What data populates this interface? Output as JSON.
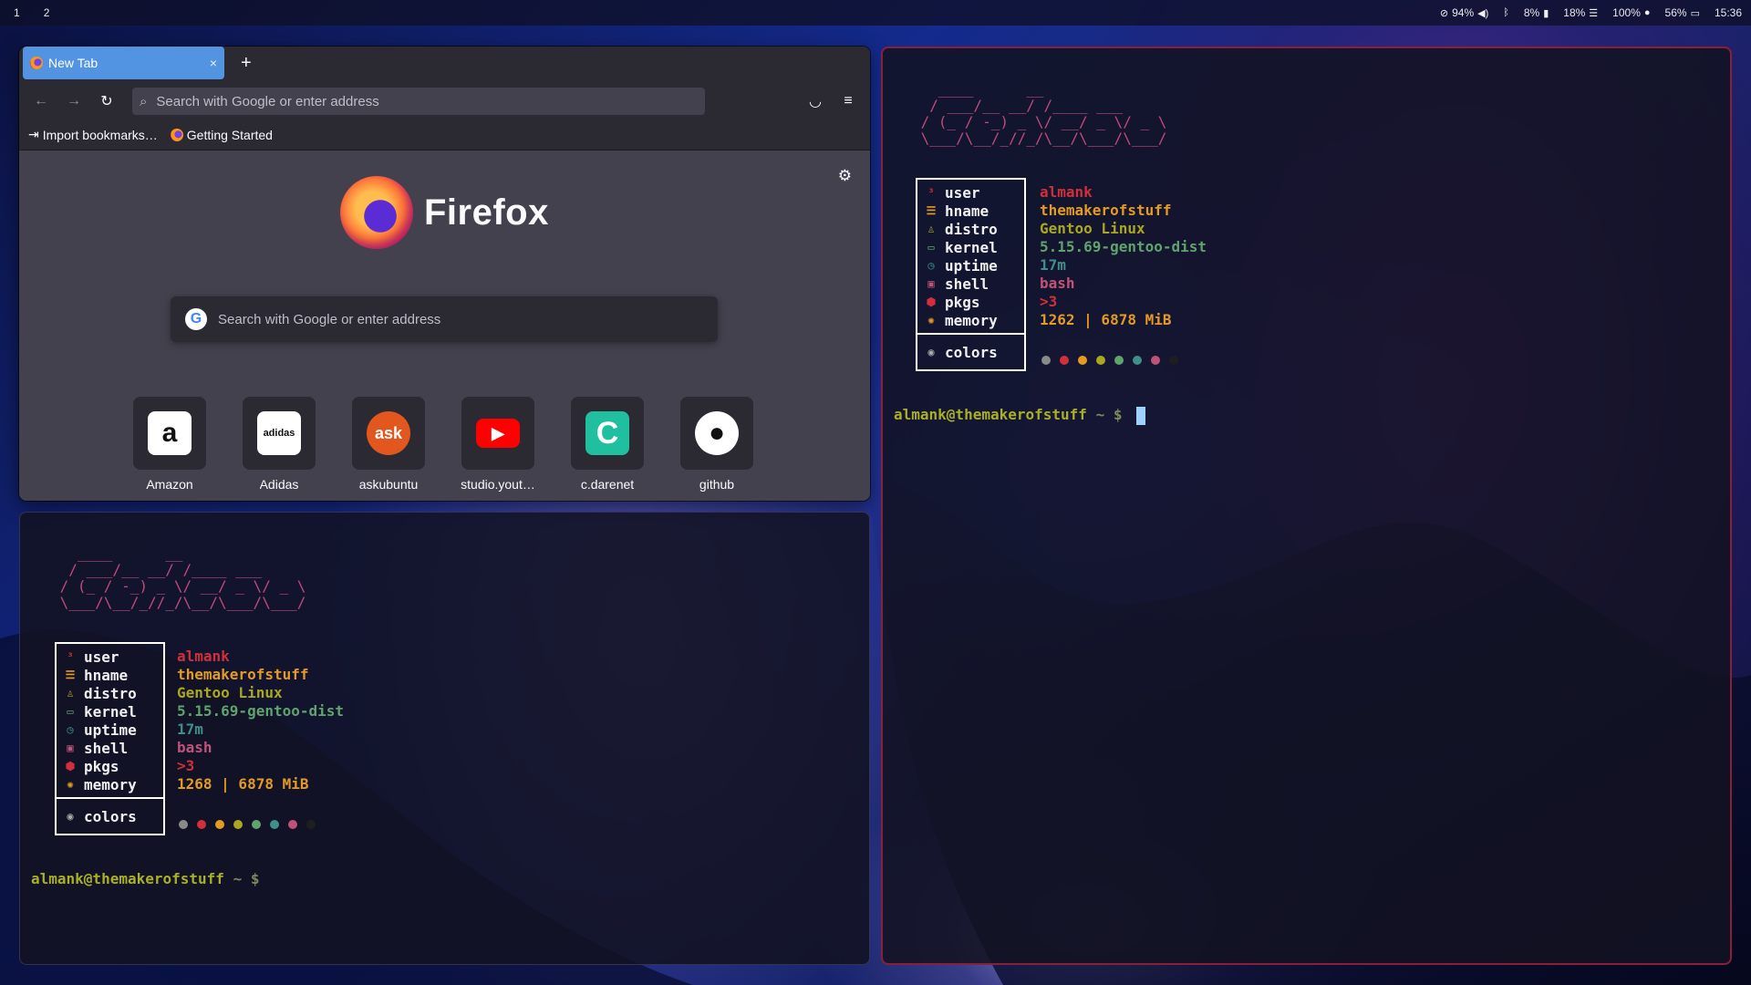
{
  "topbar": {
    "workspaces": [
      "1",
      "2"
    ],
    "status": [
      {
        "icon": "eye-slash-icon",
        "text": "94%"
      },
      {
        "icon": "volume-icon",
        "text": ""
      },
      {
        "icon": "bluetooth-off-icon",
        "text": "8%"
      },
      {
        "icon": "battery-tall-icon",
        "text": "18%"
      },
      {
        "icon": "menu-lines-icon",
        "text": "100%"
      },
      {
        "icon": "circle-icon",
        "text": "56%"
      },
      {
        "icon": "battery-icon",
        "text": ""
      }
    ],
    "clock": "15:36"
  },
  "firefox": {
    "tab_title": "New Tab",
    "tab_close": "×",
    "new_tab": "+",
    "url_placeholder": "Search with Google or enter address",
    "bookmarks": [
      "Import bookmarks…",
      "Getting Started"
    ],
    "brand": "Firefox",
    "search_placeholder": "Search with Google or enter address",
    "tiles": [
      {
        "label": "Amazon",
        "glyph": "a",
        "bg": "#ffffff",
        "fg": "#111111"
      },
      {
        "label": "Adidas",
        "glyph": "adidas",
        "bg": "#ffffff",
        "fg": "#111111"
      },
      {
        "label": "askubuntu",
        "glyph": "ask",
        "bg": "#e2571e",
        "fg": "#ffffff"
      },
      {
        "label": "studio.yout…",
        "glyph": "▶",
        "bg": "#ff0000",
        "fg": "#ffffff"
      },
      {
        "label": "c.darenet",
        "glyph": "C",
        "bg": "#1fbf9f",
        "fg": "#ffffff"
      },
      {
        "label": "github",
        "glyph": "●",
        "bg": "#ffffff",
        "fg": "#111111"
      }
    ]
  },
  "terminal_left": {
    "info": [
      {
        "key": "user",
        "value": "almank",
        "color": "#d12f3a"
      },
      {
        "key": "hname",
        "value": "themakerofstuff",
        "color": "#e59a22"
      },
      {
        "key": "distro",
        "value": "Gentoo Linux",
        "color": "#a9a81e"
      },
      {
        "key": "kernel",
        "value": "5.15.69-gentoo-dist",
        "color": "#5fa36d"
      },
      {
        "key": "uptime",
        "value": "17m",
        "color": "#3f8f8a"
      },
      {
        "key": "shell",
        "value": "bash",
        "color": "#c0527a"
      },
      {
        "key": "pkgs",
        "value": ">3",
        "color": "#d12f3a"
      },
      {
        "key": "memory",
        "value": "1268 | 6878 MiB",
        "color": "#e59a22"
      }
    ],
    "colors_label": "colors",
    "prompt_user": "almank@themakerofstuff",
    "prompt_cwd": "~ $"
  },
  "terminal_right": {
    "info": [
      {
        "key": "user",
        "value": "almank",
        "color": "#d12f3a"
      },
      {
        "key": "hname",
        "value": "themakerofstuff",
        "color": "#e59a22"
      },
      {
        "key": "distro",
        "value": "Gentoo Linux",
        "color": "#a9a81e"
      },
      {
        "key": "kernel",
        "value": "5.15.69-gentoo-dist",
        "color": "#5fa36d"
      },
      {
        "key": "uptime",
        "value": "17m",
        "color": "#3f8f8a"
      },
      {
        "key": "shell",
        "value": "bash",
        "color": "#c0527a"
      },
      {
        "key": "pkgs",
        "value": ">3",
        "color": "#d12f3a"
      },
      {
        "key": "memory",
        "value": "1262 | 6878 MiB",
        "color": "#e59a22"
      }
    ],
    "colors_label": "colors",
    "prompt_user": "almank@themakerofstuff",
    "prompt_cwd": "~ $"
  },
  "palette": [
    "#8a8a8a",
    "#d12f3a",
    "#e59a22",
    "#a9a81e",
    "#5fa36d",
    "#3f8f8a",
    "#c0527a",
    "#1e1e1e"
  ],
  "icons": {
    "user": "³",
    "hname": "☰",
    "distro": "♙",
    "kernel": "▭",
    "uptime": "◷",
    "shell": "▣",
    "pkgs": "⬢",
    "memory": "✺",
    "colors": "◉"
  }
}
